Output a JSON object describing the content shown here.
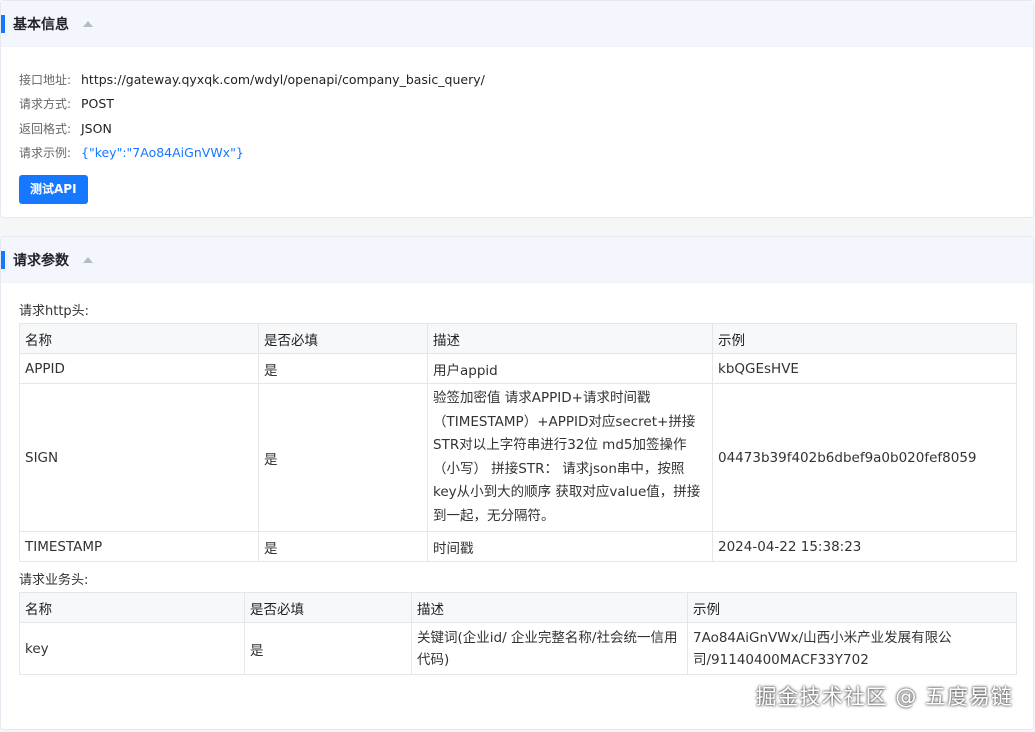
{
  "basic": {
    "title": "基本信息",
    "rows": [
      {
        "label": "接口地址:",
        "value": "https://gateway.qyxqk.com/wdyl/openapi/company_basic_query/"
      },
      {
        "label": "请求方式:",
        "value": "POST"
      },
      {
        "label": "返回格式:",
        "value": "JSON"
      },
      {
        "label": "请求示例:",
        "value": "{\"key\":\"7Ao84AiGnVWx\"}"
      }
    ],
    "test_button": "测试API"
  },
  "params": {
    "title": "请求参数",
    "http_label": "请求http头:",
    "http_headers": [
      "名称",
      "是否必填",
      "描述",
      "示例"
    ],
    "http_rows": [
      {
        "name": "APPID",
        "required": "是",
        "desc": "用户appid",
        "example": "kbQGEsHVE"
      },
      {
        "name": "SIGN",
        "required": "是",
        "desc": "验签加密值 请求APPID+请求时间戳（TIMESTAMP）+APPID对应secret+拼接STR对以上字符串进行32位 md5加签操作（小写） 拼接STR： 请求json串中，按照key从小到大的顺序 获取对应value值，拼接到一起，无分隔符。",
        "example": "04473b39f402b6dbef9a0b020fef8059"
      },
      {
        "name": "TIMESTAMP",
        "required": "是",
        "desc": "时间戳",
        "example": "2024-04-22 15:38:23"
      }
    ],
    "biz_label": "请求业务头:",
    "biz_headers": [
      "名称",
      "是否必填",
      "描述",
      "示例"
    ],
    "biz_rows": [
      {
        "name": "key",
        "required": "是",
        "desc": "关键词(企业id/ 企业完整名称/社会统一信用代码)",
        "example": "7Ao84AiGnVWx/山西小米产业发展有限公司/91140400MACF33Y702"
      }
    ]
  },
  "watermark": "掘金技术社区 @ 五度易链",
  "colors": {
    "accent": "#1677ff",
    "header_bg": "#f3f6fc"
  }
}
